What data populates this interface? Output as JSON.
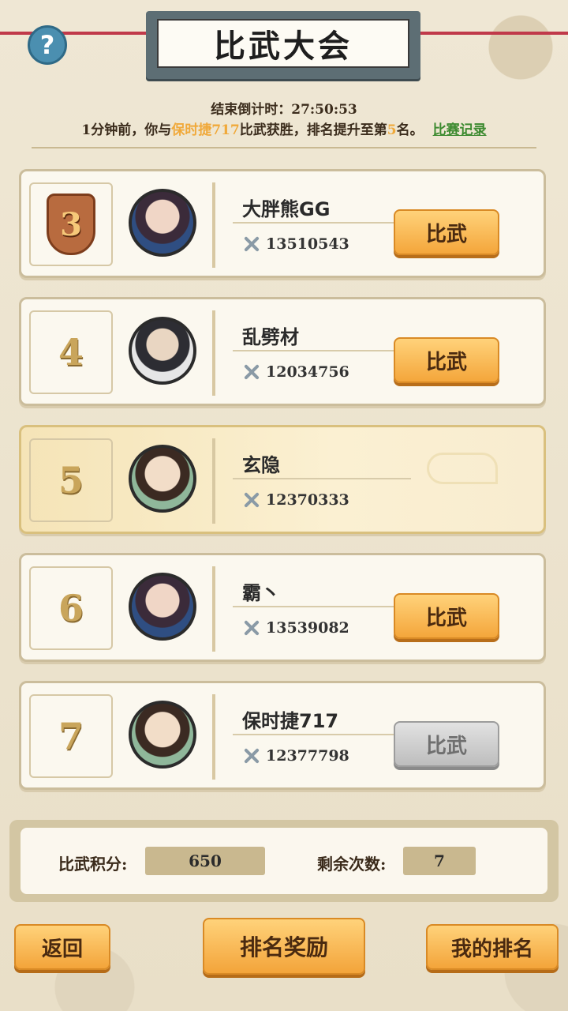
{
  "header": {
    "title": "比武大会",
    "countdown_label": "结束倒计时：",
    "countdown_value": "27:50:53",
    "news_prefix": "1分钟前，你与",
    "news_opponent": "保时捷717",
    "news_middle": "比武获胜，排名提升至第",
    "news_rank": "5",
    "news_suffix": "名。",
    "record_link": "比赛记录",
    "help_icon": "?"
  },
  "ranking": [
    {
      "rank": "3",
      "name": "大胖熊GG",
      "power": "13510543",
      "button": "比武",
      "is_badge": true,
      "is_self": false,
      "button_enabled": true
    },
    {
      "rank": "4",
      "name": "乱劈材",
      "power": "12034756",
      "button": "比武",
      "is_badge": false,
      "is_self": false,
      "button_enabled": true
    },
    {
      "rank": "5",
      "name": "玄隐",
      "power": "12370333",
      "button": "",
      "is_badge": false,
      "is_self": true,
      "button_enabled": false
    },
    {
      "rank": "6",
      "name": "霸丶",
      "power": "13539082",
      "button": "比武",
      "is_badge": false,
      "is_self": false,
      "button_enabled": true
    },
    {
      "rank": "7",
      "name": "保时捷717",
      "power": "12377798",
      "button": "比武",
      "is_badge": false,
      "is_self": false,
      "button_enabled": false
    }
  ],
  "stats": {
    "points_label": "比武积分:",
    "points_value": "650",
    "remaining_label": "剩余次数:",
    "remaining_value": "7"
  },
  "footer": {
    "back": "返回",
    "rewards": "排名奖励",
    "my_rank": "我的排名"
  },
  "colors": {
    "accent_orange": "#f4a63b",
    "highlight": "#f0a93a",
    "link_green": "#3c8a2f"
  }
}
